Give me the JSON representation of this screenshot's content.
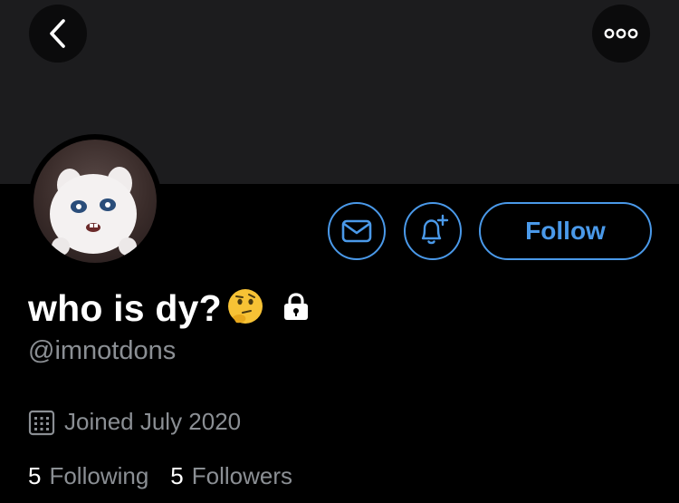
{
  "header": {
    "back_icon": "chevron-left-icon",
    "more_icon": "ellipsis-icon"
  },
  "profile": {
    "display_name": "who is dy?",
    "name_emoji": "🤔",
    "handle": "@imnotdons",
    "joined": "Joined July 2020",
    "following_count": "5",
    "following_label": "Following",
    "followers_count": "5",
    "followers_label": "Followers",
    "avatar_description_icon": "avatar"
  },
  "actions": {
    "follow_label": "Follow",
    "message_icon": "envelope-icon",
    "notify_icon": "bell-plus-icon"
  },
  "colors": {
    "accent": "#4a99e9",
    "banner": "#1c1c1e",
    "background": "#000000",
    "secondary_text": "#8b8f94"
  }
}
